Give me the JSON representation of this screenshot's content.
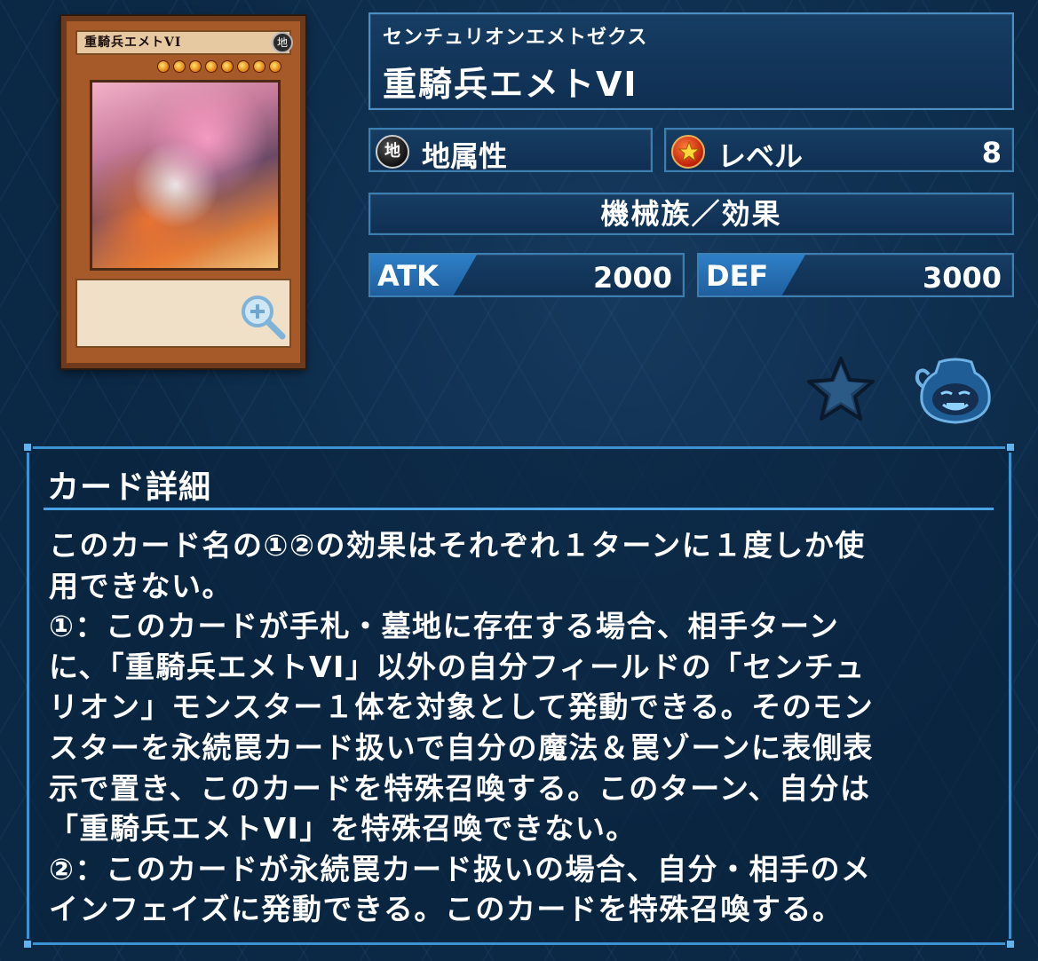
{
  "card": {
    "ruby": "センチュリオンエメトゼクス",
    "name": "重騎兵エメトVI",
    "attribute_icon_char": "地",
    "attribute_label": "地属性",
    "level_label": "レベル",
    "level_value": "8",
    "type": "機械族／効果",
    "atk_label": "ATK",
    "atk_value": "2000",
    "def_label": "DEF",
    "def_value": "3000",
    "image_name": "重騎兵エメトVI",
    "image_attribute": "地"
  },
  "icons": {
    "attribute": "earth-attribute-icon",
    "level": "level-star-icon",
    "zoom": "magnifier-plus-icon",
    "favorite": "star-icon",
    "pot": "pot-of-greed-icon"
  },
  "colors": {
    "background": "#0b2845",
    "panel_border": "#3c7fb3",
    "accent": "#2e7fc7",
    "card_frame": "#a65a2a"
  },
  "details": {
    "title": "カード詳細",
    "lines": [
      "このカード名の①②の効果はそれぞれ１ターンに１度しか使",
      "用できない。",
      "①：このカードが手札・墓地に存在する場合、相手ターン",
      "に、「重騎兵エメトVI」以外の自分フィールドの「センチュ",
      "リオン」モンスター１体を対象として発動できる。そのモン",
      "スターを永続罠カード扱いで自分の魔法＆罠ゾーンに表側表",
      "示で置き、このカードを特殊召喚する。このターン、自分は",
      "「重騎兵エメトVI」を特殊召喚できない。",
      "②：このカードが永続罠カード扱いの場合、自分・相手のメ",
      "インフェイズに発動できる。このカードを特殊召喚する。"
    ]
  }
}
